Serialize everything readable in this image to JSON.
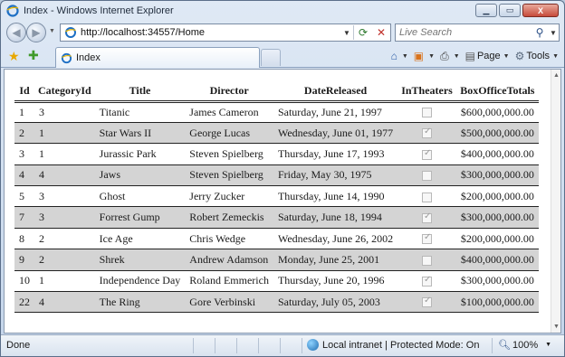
{
  "window": {
    "title": "Index - Windows Internet Explorer",
    "minimize": "▁",
    "maximize": "▭",
    "close": "X"
  },
  "navigation": {
    "address": "http://localhost:34557/Home",
    "search_placeholder": "Live Search"
  },
  "tab": {
    "label": "Index"
  },
  "command_bar": {
    "page_label": "Page",
    "tools_label": "Tools"
  },
  "table": {
    "headers": [
      "Id",
      "CategoryId",
      "Title",
      "Director",
      "DateReleased",
      "InTheaters",
      "BoxOfficeTotals"
    ],
    "rows": [
      {
        "id": "1",
        "category": "3",
        "title": "Titanic",
        "director": "James Cameron",
        "date": "Saturday, June 21, 1997",
        "in_theaters": false,
        "box_office": "$600,000,000.00"
      },
      {
        "id": "2",
        "category": "1",
        "title": "Star Wars II",
        "director": "George Lucas",
        "date": "Wednesday, June 01, 1977",
        "in_theaters": true,
        "box_office": "$500,000,000.00"
      },
      {
        "id": "3",
        "category": "1",
        "title": "Jurassic Park",
        "director": "Steven Spielberg",
        "date": "Thursday, June 17, 1993",
        "in_theaters": true,
        "box_office": "$400,000,000.00"
      },
      {
        "id": "4",
        "category": "4",
        "title": "Jaws",
        "director": "Steven Spielberg",
        "date": "Friday, May 30, 1975",
        "in_theaters": false,
        "box_office": "$300,000,000.00"
      },
      {
        "id": "5",
        "category": "3",
        "title": "Ghost",
        "director": "Jerry Zucker",
        "date": "Thursday, June 14, 1990",
        "in_theaters": false,
        "box_office": "$200,000,000.00"
      },
      {
        "id": "7",
        "category": "3",
        "title": "Forrest Gump",
        "director": "Robert Zemeckis",
        "date": "Saturday, June 18, 1994",
        "in_theaters": true,
        "box_office": "$300,000,000.00"
      },
      {
        "id": "8",
        "category": "2",
        "title": "Ice Age",
        "director": "Chris Wedge",
        "date": "Wednesday, June 26, 2002",
        "in_theaters": true,
        "box_office": "$200,000,000.00"
      },
      {
        "id": "9",
        "category": "2",
        "title": "Shrek",
        "director": "Andrew Adamson",
        "date": "Monday, June 25, 2001",
        "in_theaters": false,
        "box_office": "$400,000,000.00"
      },
      {
        "id": "10",
        "category": "1",
        "title": "Independence Day",
        "director": "Roland Emmerich",
        "date": "Thursday, June 20, 1996",
        "in_theaters": true,
        "box_office": "$300,000,000.00"
      },
      {
        "id": "22",
        "category": "4",
        "title": "The Ring",
        "director": "Gore Verbinski",
        "date": "Saturday, July 05, 2003",
        "in_theaters": true,
        "box_office": "$100,000,000.00"
      }
    ]
  },
  "status": {
    "text": "Done",
    "zone": "Local intranet | Protected Mode: On",
    "zoom": "100%"
  },
  "colors": {
    "alt_row": "#d4d4d4",
    "frame": "#c4d5ea"
  }
}
